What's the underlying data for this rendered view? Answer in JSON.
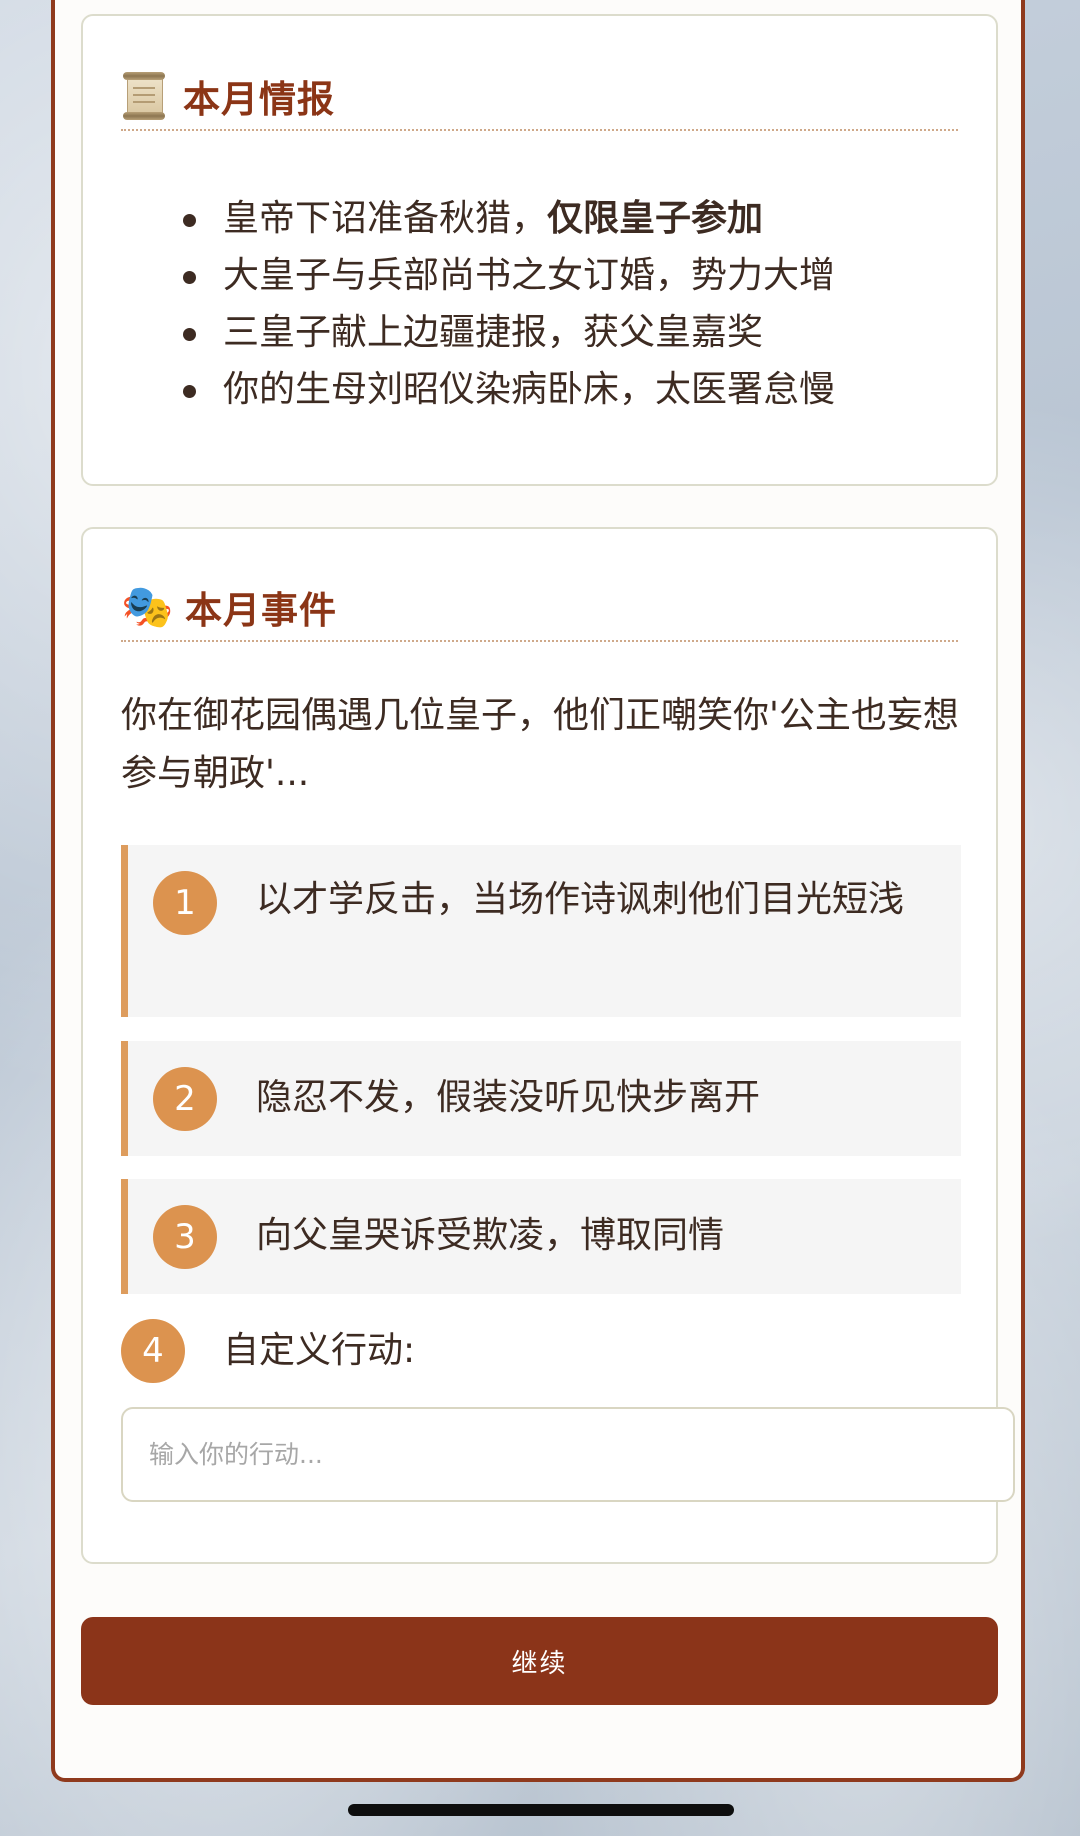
{
  "intel": {
    "icon": "scroll-icon",
    "title": "本月情报",
    "items": [
      {
        "text": "皇帝下诏准备秋猎，",
        "bold": "仅限皇子参加"
      },
      {
        "text": "大皇子与兵部尚书之女订婚，势力大增",
        "bold": ""
      },
      {
        "text": "三皇子献上边疆捷报，获父皇嘉奖",
        "bold": ""
      },
      {
        "text": "你的生母刘昭仪染病卧床，太医署怠慢",
        "bold": ""
      }
    ]
  },
  "event": {
    "icon": "performing-arts-icon",
    "icon_glyph": "🎭",
    "title": "本月事件",
    "description": "你在御花园偶遇几位皇子，他们正嘲笑你'公主也妄想参与朝政'...",
    "options": [
      {
        "number": "1",
        "text": "以才学反击，当场作诗讽刺他们目光短浅"
      },
      {
        "number": "2",
        "text": "隐忍不发，假装没听见快步离开"
      },
      {
        "number": "3",
        "text": "向父皇哭诉受欺凌，博取同情"
      }
    ],
    "custom": {
      "number": "4",
      "label": "自定义行动:",
      "placeholder": "输入你的行动...",
      "value": ""
    }
  },
  "continue_label": "继续",
  "colors": {
    "accent": "#8b3419",
    "badge": "#dc934f",
    "option_border": "#dd9c5d",
    "title": "#8b3516"
  }
}
